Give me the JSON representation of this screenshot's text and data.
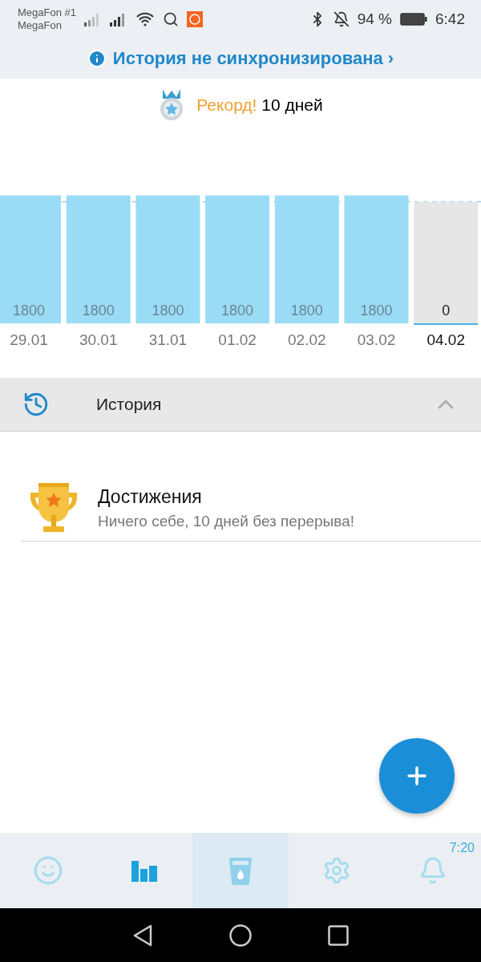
{
  "status_bar": {
    "carrier_1": "MegaFon #1",
    "carrier_2": "MegaFon",
    "battery": "94 %",
    "time": "6:42"
  },
  "sync_banner": {
    "text": "История не синхронизирована ›"
  },
  "record": {
    "label": "Рекорд!",
    "value": "10 дней"
  },
  "chart": {
    "chart_data": {
      "type": "bar",
      "categories": [
        "29.01",
        "30.01",
        "31.01",
        "01.02",
        "02.02",
        "03.02",
        "04.02"
      ],
      "series": [
        {
          "color": "#9adcf6",
          "values": [
            1800,
            1800,
            1800,
            1800,
            1800,
            1800,
            0
          ]
        }
      ],
      "data_labels": true
    },
    "days": [
      {
        "selected": false
      },
      {
        "selected": false
      },
      {
        "selected": false
      },
      {
        "selected": false
      },
      {
        "selected": false
      },
      {
        "selected": false
      },
      {
        "selected": true
      }
    ]
  },
  "history_section": {
    "title": "История",
    "expanded": true
  },
  "achievements": {
    "title": "Достижения",
    "subtitle": "Ничего себе, 10 дней без перерыва!"
  },
  "bottom_nav": [
    {
      "selected": false,
      "highlighted": false
    },
    {
      "selected": true,
      "highlighted": false
    },
    {
      "selected": false,
      "highlighted": true
    },
    {
      "selected": false,
      "highlighted": false
    },
    {
      "selected": false,
      "highlighted": false,
      "badge": "7:20"
    }
  ]
}
